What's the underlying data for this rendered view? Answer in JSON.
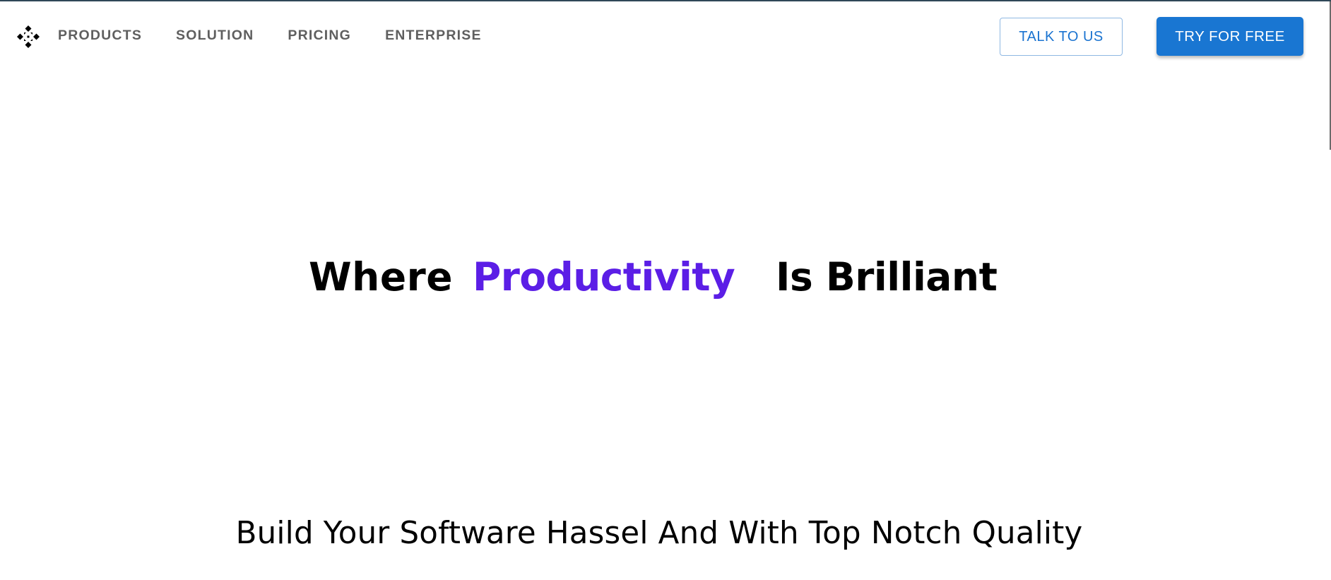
{
  "header": {
    "logo_icon": "diamond-dots-logo-icon",
    "nav": [
      {
        "label": "PRODUCTS"
      },
      {
        "label": "SOLUTION"
      },
      {
        "label": "PRICING"
      },
      {
        "label": "ENTERPRISE"
      }
    ],
    "talk_button_label": "TALK TO US",
    "try_button_label": "TRY FOR FREE"
  },
  "hero": {
    "headline_word1": "Where",
    "headline_highlight": "Productivity",
    "headline_word3": "Is Brilliant",
    "subheadline": "Build Your Software Hassel And With Top Notch Quality"
  },
  "colors": {
    "accent": "#5b1ee6",
    "primary_button": "#1976d2",
    "nav_text": "#5f5f5f"
  }
}
